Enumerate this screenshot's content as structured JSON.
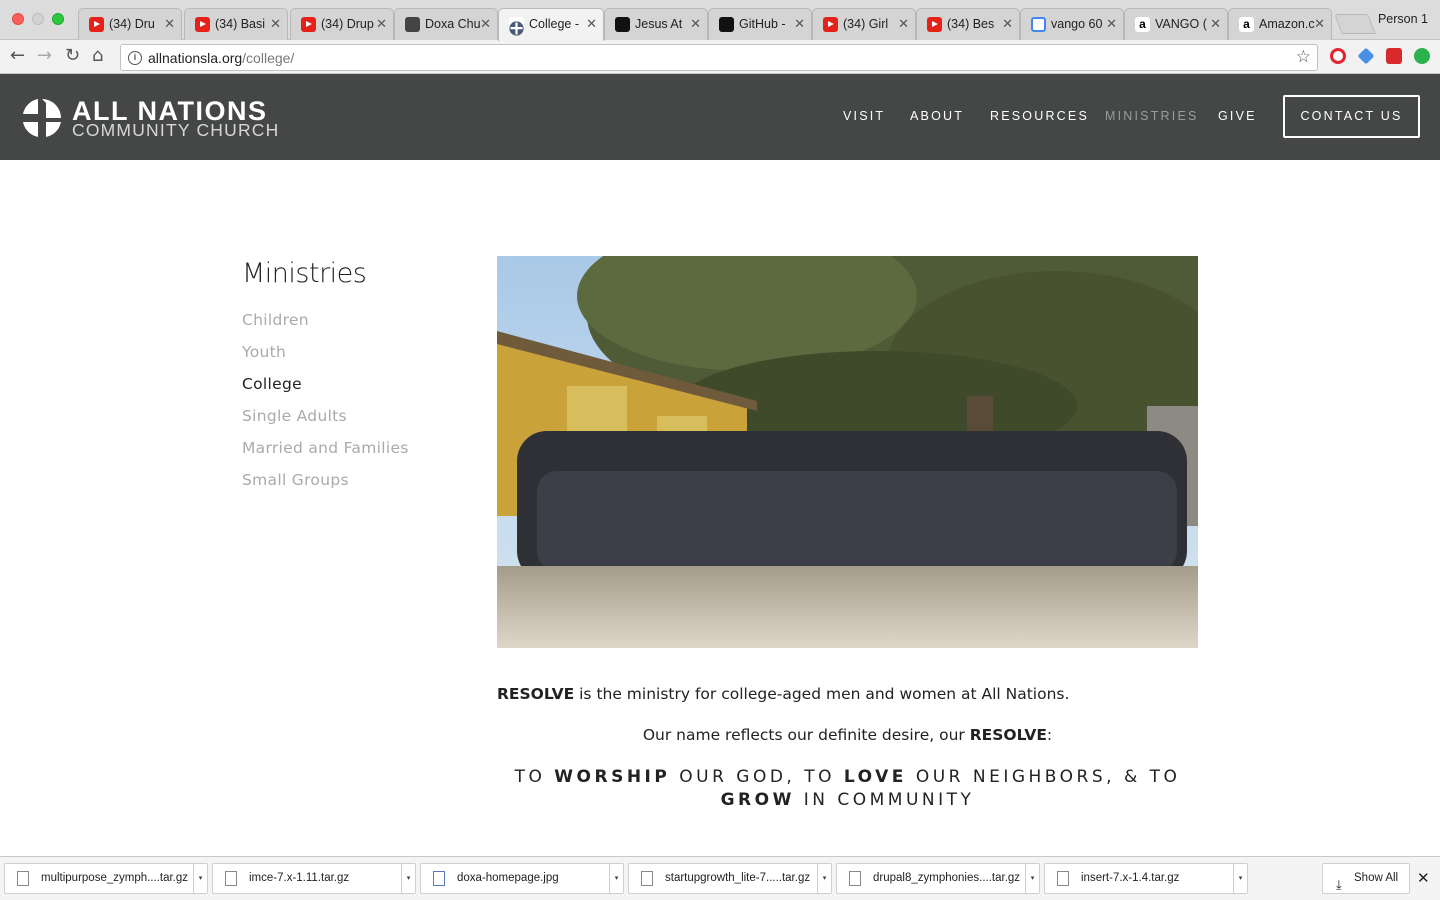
{
  "browser": {
    "tabs": [
      {
        "title": "(34) Dru",
        "icon": "youtube-icon"
      },
      {
        "title": "(34) Basi",
        "icon": "youtube-icon"
      },
      {
        "title": "(34) Drup",
        "icon": "youtube-icon"
      },
      {
        "title": "Doxa Chu",
        "icon": "doxa-icon"
      },
      {
        "title": "College -",
        "icon": "all-nations-icon",
        "active": true
      },
      {
        "title": "Jesus At",
        "icon": "jesus-at-icon"
      },
      {
        "title": "GitHub -",
        "icon": "github-icon"
      },
      {
        "title": "(34) Girl",
        "icon": "youtube-icon"
      },
      {
        "title": "(34) Bes",
        "icon": "youtube-icon"
      },
      {
        "title": "vango 60",
        "icon": "google-icon"
      },
      {
        "title": "VANGO (",
        "icon": "amazon-icon"
      },
      {
        "title": "Amazon.c",
        "icon": "amazon-icon"
      }
    ],
    "tab_close_glyph": "✕",
    "amazon_glyph": "a",
    "profile_name": "Person 1",
    "url_host": "allnationsla.org",
    "url_path": "/college/",
    "info_glyph": "i",
    "back_glyph": "←",
    "forward_glyph": "→",
    "reload_glyph": "↻",
    "home_glyph": "⌂",
    "star_glyph": "☆"
  },
  "site": {
    "logo_line1": "ALL NATIONS",
    "logo_line2": "COMMUNITY CHURCH",
    "nav": [
      "VISIT",
      "ABOUT",
      "RESOURCES",
      "MINISTRIES",
      "GIVE"
    ],
    "contact_label": "CONTACT US",
    "header_bg": "#444746"
  },
  "sidebar": {
    "title": "Ministries",
    "links": [
      "Children",
      "Youth",
      "College",
      "Single Adults",
      "Married and Families",
      "Small Groups"
    ],
    "current": "College"
  },
  "content": {
    "p1_strong": "RESOLVE",
    "p1_rest": " is the ministry for college-aged men and women at All Nations.",
    "p2_start": "Our name reflects our definite desire, our ",
    "p2_strong": "RESOLVE",
    "p2_end": ":",
    "motto": [
      {
        "text": "TO ",
        "bold": false
      },
      {
        "text": "WORSHIP",
        "bold": true
      },
      {
        "text": " OUR GOD, TO ",
        "bold": false
      },
      {
        "text": "LOVE",
        "bold": true
      },
      {
        "text": " OUR NEIGHBORS, & TO ",
        "bold": false
      },
      {
        "text": "GROW",
        "bold": true
      },
      {
        "text": " IN COMMUNITY",
        "bold": false
      }
    ]
  },
  "downloads": {
    "files": [
      "multipurpose_zymph....tar.gz",
      "imce-7.x-1.11.tar.gz",
      "doxa-homepage.jpg",
      "startupgrowth_lite-7.....tar.gz",
      "drupal8_zymphonies....tar.gz",
      "insert-7.x-1.4.tar.gz"
    ],
    "menu_glyph": "▾",
    "download_glyph": "⤓",
    "show_all_label": "Show All",
    "close_glyph": "✕"
  }
}
